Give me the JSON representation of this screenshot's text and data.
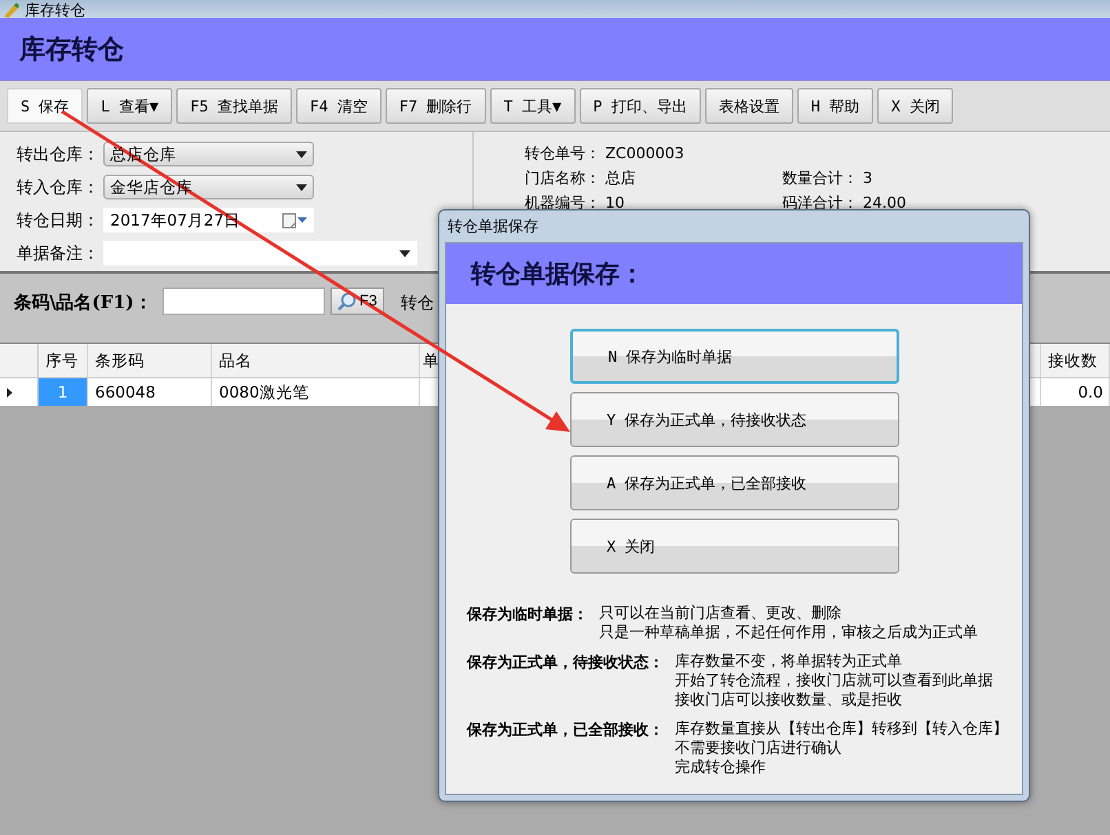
{
  "window": {
    "title": "库存转仓"
  },
  "header": {
    "title": "库存转仓"
  },
  "toolbar": [
    {
      "label": "S 保存",
      "selected": true
    },
    {
      "label": "L 查看▼",
      "selected": false
    },
    {
      "label": "F5 查找单据",
      "selected": false
    },
    {
      "label": "F4 清空",
      "selected": false
    },
    {
      "label": "F7 删除行",
      "selected": false
    },
    {
      "label": "T 工具▼",
      "selected": false
    },
    {
      "label": "P 打印、导出",
      "selected": false
    },
    {
      "label": "表格设置",
      "selected": false
    },
    {
      "label": "H 帮助",
      "selected": false
    },
    {
      "label": "X 关闭",
      "selected": false
    }
  ],
  "form": {
    "fields": [
      {
        "label": "转出仓库：",
        "value": "总店仓库",
        "kind": "dropdown"
      },
      {
        "label": "转入仓库：",
        "value": "金华店仓库",
        "kind": "dropdown"
      },
      {
        "label": "转仓日期：",
        "value": "2017年07月27日",
        "kind": "date"
      },
      {
        "label": "单据备注：",
        "kind": "combo"
      }
    ],
    "info": [
      {
        "left": {
          "label": "转仓单号：",
          "value": "ZC000003"
        }
      },
      {
        "left": {
          "label": "门店名称：",
          "value": "总店"
        },
        "right": {
          "label": "数量合计：",
          "value": "3"
        }
      },
      {
        "left": {
          "label": "机器编号：",
          "value": "10"
        },
        "right": {
          "label": "码洋合计：",
          "value": "24.00"
        }
      }
    ]
  },
  "search": {
    "label": "条码\\品名(F1)：",
    "button": "F3",
    "trailing_label": "转仓"
  },
  "table": {
    "columns": [
      "序号",
      "条形码",
      "品名",
      "单",
      "接收数"
    ],
    "rows": [
      {
        "selected": true,
        "cells": [
          "1",
          "660048",
          "0080激光笔",
          null,
          "0.0"
        ]
      }
    ]
  },
  "dialog": {
    "title": "转仓单据保存",
    "heading": "转仓单据保存：",
    "options": [
      {
        "label": "N 保存为临时单据",
        "selected": true
      },
      {
        "label": "Y 保存为正式单，待接收状态",
        "selected": false
      },
      {
        "label": "A 保存为正式单，已全部接收",
        "selected": false
      },
      {
        "label": "X 关闭",
        "selected": false
      }
    ],
    "notes": [
      {
        "term": "保存为临时单据：",
        "lines": [
          "只可以在当前门店查看、更改、删除",
          "只是一种草稿单据，不起任何作用，审核之后成为正式单"
        ]
      },
      {
        "term": "保存为正式单，待接收状态：",
        "lines": [
          "库存数量不变，将单据转为正式单",
          "开始了转仓流程，接收门店就可以查看到此单据",
          "接收门店可以接收数量、或是拒收"
        ]
      },
      {
        "term": "保存为正式单，已全部接收：",
        "lines": [
          "库存数量直接从【转出仓库】转移到【转入仓库】",
          "不需要接收门店进行确认",
          "完成转仓操作"
        ]
      }
    ]
  }
}
